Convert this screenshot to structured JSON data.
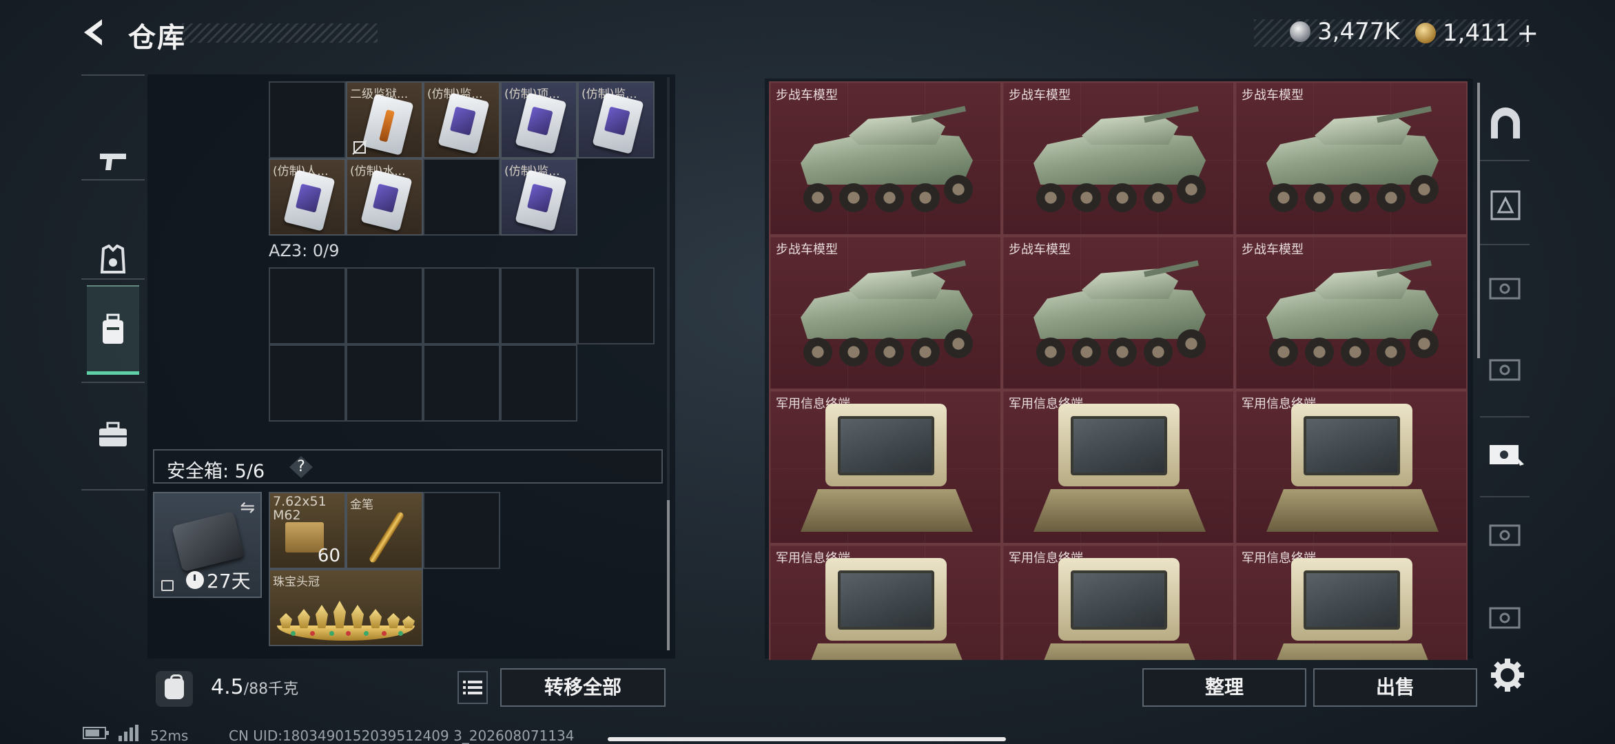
{
  "header": {
    "title": "仓库",
    "currency_silver": "3,477K",
    "currency_gold": "1,411",
    "plus": "+"
  },
  "left_nav": {
    "tabs": [
      "weapons",
      "equipment",
      "backpack",
      "toolbox"
    ],
    "active": "backpack"
  },
  "container_az2": {
    "items": [
      {
        "label": "二级监狱...",
        "style": "brown",
        "col": 1,
        "row": 0,
        "variant": "orange",
        "locked": true
      },
      {
        "label": "(仿制)监...",
        "style": "brown",
        "col": 2,
        "row": 0
      },
      {
        "label": "(仿制)项...",
        "style": "blue",
        "col": 3,
        "row": 0
      },
      {
        "label": "(仿制)监...",
        "style": "blue",
        "col": 4,
        "row": 0
      },
      {
        "label": "(仿制)人...",
        "style": "brown",
        "col": 0,
        "row": 1
      },
      {
        "label": "(仿制)水...",
        "style": "brown",
        "col": 1,
        "row": 1
      },
      {
        "label": "(仿制)监...",
        "style": "blue",
        "col": 3,
        "row": 1
      }
    ]
  },
  "container_az3": {
    "label": "AZ3: 0/9"
  },
  "safe_box": {
    "title": "安全箱: 5/6",
    "help": "?",
    "timer": "27天",
    "items": {
      "ammo": {
        "label": "7.62x51\nM62",
        "count": "60"
      },
      "pen": {
        "label": "金笔"
      },
      "crown": {
        "label": "珠宝头冠"
      }
    }
  },
  "weight": {
    "current": "4.5",
    "max": "/88千克"
  },
  "buttons": {
    "transfer_all": "转移全部",
    "sort": "整理",
    "sell": "出售"
  },
  "stash": {
    "items": [
      {
        "label": "步战车模型",
        "kind": "vehicle"
      },
      {
        "label": "步战车模型",
        "kind": "vehicle"
      },
      {
        "label": "步战车模型",
        "kind": "vehicle"
      },
      {
        "label": "步战车模型",
        "kind": "vehicle"
      },
      {
        "label": "步战车模型",
        "kind": "vehicle"
      },
      {
        "label": "步战车模型",
        "kind": "vehicle"
      },
      {
        "label": "军用信息终端",
        "kind": "terminal"
      },
      {
        "label": "军用信息终端",
        "kind": "terminal"
      },
      {
        "label": "军用信息终端",
        "kind": "terminal"
      },
      {
        "label": "军用信息终端",
        "kind": "terminal"
      },
      {
        "label": "军用信息终端",
        "kind": "terminal"
      },
      {
        "label": "军用信息终端",
        "kind": "terminal"
      }
    ]
  },
  "status_bar": {
    "ping": "52ms",
    "uid": "CN UID:1803490152039512409 3_202608071134"
  },
  "colors": {
    "accent": "#5fd0a8",
    "stash_cell": "#4a1e26"
  }
}
